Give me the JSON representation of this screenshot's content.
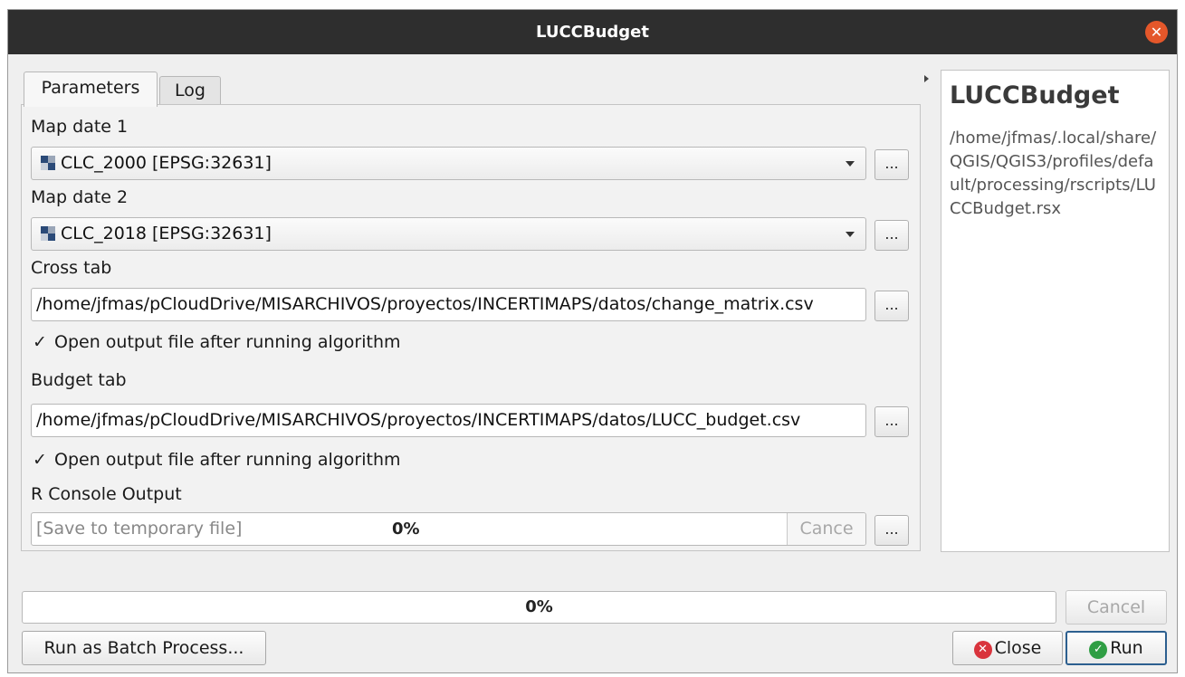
{
  "window": {
    "title": "LUCCBudget",
    "close_glyph": "✕"
  },
  "tabs": [
    {
      "label": "Parameters",
      "active": true
    },
    {
      "label": "Log",
      "active": false
    }
  ],
  "params": {
    "map_date_1": {
      "label": "Map date 1",
      "value": "CLC_2000 [EPSG:32631]",
      "button": "..."
    },
    "map_date_2": {
      "label": "Map date 2",
      "value": "CLC_2018 [EPSG:32631]",
      "button": "..."
    },
    "cross_tab": {
      "label": "Cross tab",
      "value": "/home/jfmas/pCloudDrive/MISARCHIVOS/proyectos/INCERTIMAPS/datos/change_matrix.csv",
      "button": "...",
      "open_after": {
        "label": "Open output file after running algorithm",
        "checked": true
      }
    },
    "budget_tab": {
      "label": "Budget tab",
      "value": "/home/jfmas/pCloudDrive/MISARCHIVOS/proyectos/INCERTIMAPS/datos/LUCC_budget.csv",
      "button": "...",
      "open_after": {
        "label": "Open output file after running algorithm",
        "checked": true
      }
    },
    "r_console": {
      "label": "R Console Output",
      "value": "[Save to temporary file]",
      "progress_text": "0%",
      "cancel_label": "Cance",
      "button": "..."
    }
  },
  "help": {
    "title": "LUCCBudget",
    "path": "/home/jfmas/.local/share/QGIS/QGIS3/profiles/default/processing/rscripts/LUCCBudget.rsx"
  },
  "footer": {
    "progress": 0,
    "progress_text": "0%",
    "cancel_label": "Cancel",
    "batch_label": "Run as Batch Process...",
    "close_label": "Close",
    "run_label": "Run"
  },
  "colors": {
    "titlebar": "#2e2e2e",
    "close_circle": "#e4572a",
    "close_icon": "#d9343d",
    "run_icon": "#2f9e44"
  },
  "check_glyph": "✓",
  "icons": {
    "raster_layer": "raster-layer-icon",
    "close_button": "close-circle-icon",
    "run_button": "check-circle-icon"
  }
}
